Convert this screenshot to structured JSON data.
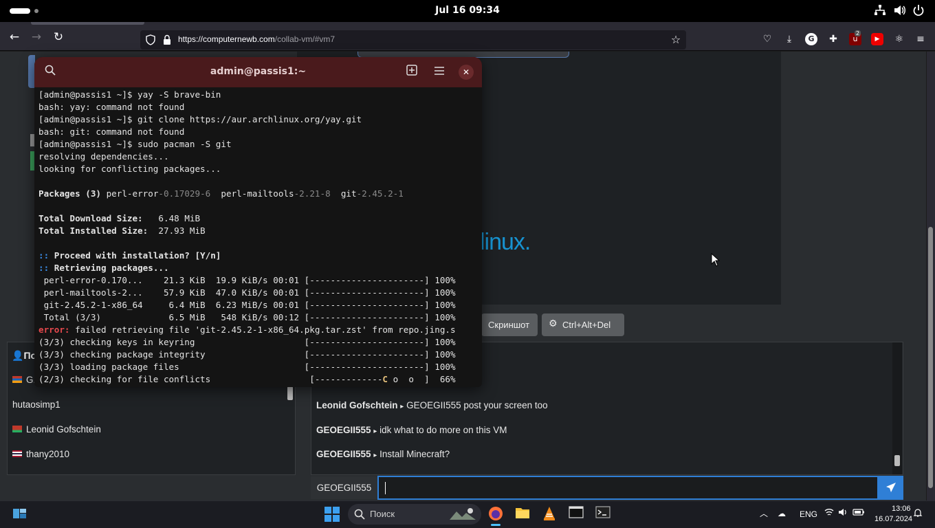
{
  "topbar": {
    "clock": "Jul 16  09:34",
    "icons": [
      "network-icon",
      "volume-icon",
      "power-icon"
    ]
  },
  "browser": {
    "url_host": "https://computernewb.com",
    "url_path": "/collab-vm/#vm7",
    "extension_badge": "2"
  },
  "vm": {
    "arch_logo_text": "linux.",
    "buttons": {
      "screenshot": "Скриншот",
      "ctrl_alt_del": "Ctrl+Alt+Del"
    }
  },
  "terminal": {
    "title": "admin@passis1:~",
    "lines": [
      "[admin@passis1 ~]$ yay -S brave-bin",
      "bash: yay: command not found",
      "[admin@passis1 ~]$ git clone https://aur.archlinux.org/yay.git",
      "bash: git: command not found",
      "[admin@passis1 ~]$ sudo pacman -S git",
      "resolving dependencies...",
      "looking for conflicting packages..."
    ],
    "packages_label": "Packages (3)",
    "packages": [
      {
        "name": "perl-error",
        "version": "-0.17029-6"
      },
      {
        "name": "perl-mailtools",
        "version": "-2.21-8"
      },
      {
        "name": "git",
        "version": "-2.45.2-1"
      }
    ],
    "download_size_label": "Total Download Size:",
    "download_size": "   6.48 MiB",
    "installed_size_label": "Total Installed Size:",
    "installed_size": "  27.93 MiB",
    "proceed_prefix": "::",
    "proceed_text": " Proceed with installation? [Y/n]",
    "retrieving_prefix": "::",
    "retrieving_text": " Retrieving packages...",
    "downloads": [
      " perl-error-0.170...    21.3 KiB  19.9 KiB/s 00:01 [----------------------] 100%",
      " perl-mailtools-2...    57.9 KiB  47.0 KiB/s 00:01 [----------------------] 100%",
      " git-2.45.2-1-x86_64     6.4 MiB  6.23 MiB/s 00:01 [----------------------] 100%",
      " Total (3/3)             6.5 MiB   548 KiB/s 00:12 [----------------------] 100%"
    ],
    "error_prefix": "error:",
    "error_text": " failed retrieving file 'git-2.45.2-1-x86_64.pkg.tar.zst' from repo.jing.s",
    "checks": [
      "(3/3) checking keys in keyring                     [----------------------] 100%",
      "(3/3) checking package integrity                   [----------------------] 100%",
      "(3/3) loading package files                        [----------------------] 100%"
    ],
    "last_check_prefix": "(2/3) checking for file conflicts                   [-------------",
    "last_check_pacman": "C",
    "last_check_dots": " o  o  ]",
    "last_check_pct": "  66%"
  },
  "users": {
    "header": "По",
    "list": [
      {
        "name": "G.",
        "flag": "#c0392b"
      },
      {
        "name": "hutaosimp1",
        "flag": ""
      },
      {
        "name": "Leonid Gofschtein",
        "flag": "#c0392b"
      },
      {
        "name": "thany2010",
        "flag": "#a51931"
      }
    ]
  },
  "chat": {
    "messages": [
      {
        "user": "Leonid Gofschtein",
        "text": "GEOEGII555 post your screen too"
      },
      {
        "user": "GEOEGII555",
        "text": "idk what to do more on this VM"
      },
      {
        "user": "GEOEGII555",
        "text": "Install Minecraft?"
      }
    ],
    "username": "GEOEGII555",
    "input_value": "",
    "separator": "▸"
  },
  "taskbar": {
    "search_placeholder": "Поиск",
    "lang": "ENG",
    "time": "13:06",
    "date": "16.07.2024"
  }
}
